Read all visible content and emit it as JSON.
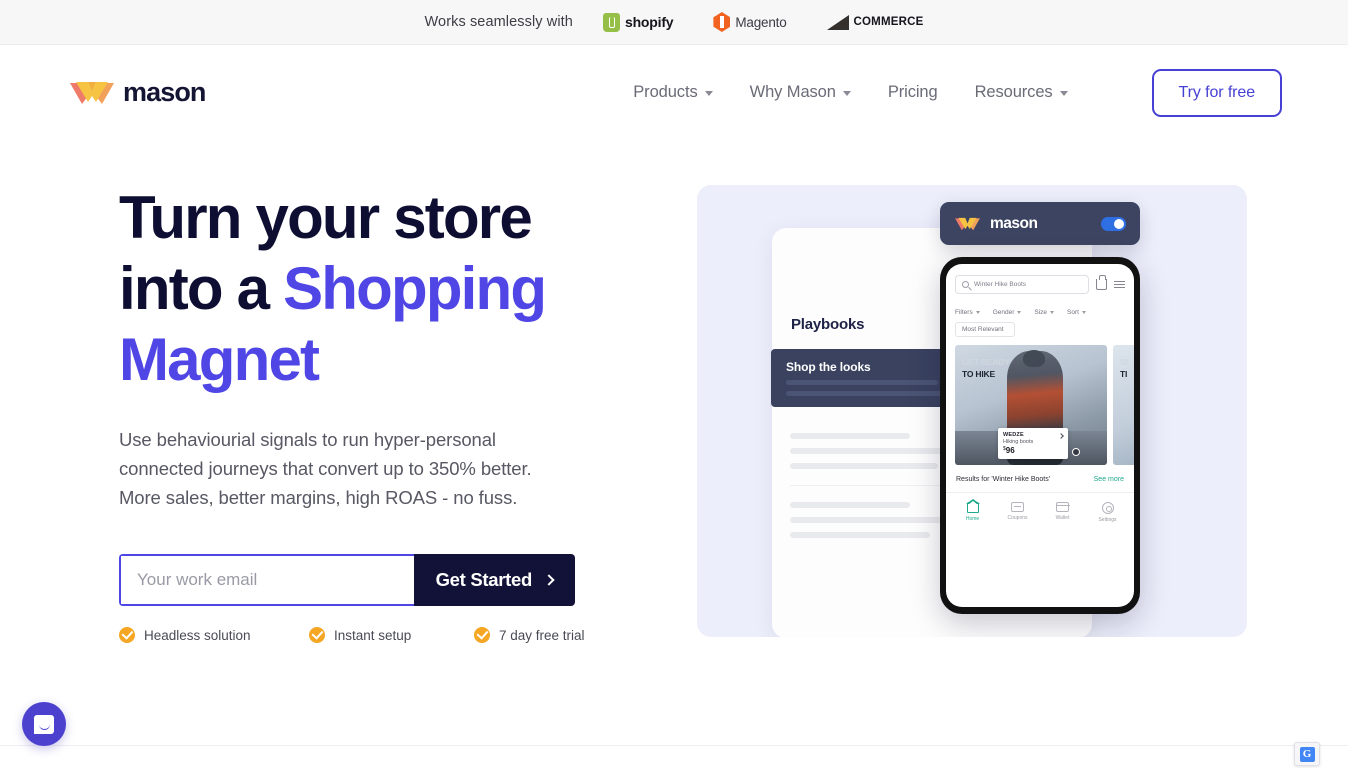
{
  "announcement": {
    "text": "Works seamlessly with",
    "platforms": [
      {
        "name": "shopify",
        "icon": "shopify-icon"
      },
      {
        "name": "Magento",
        "icon": "magento-icon"
      },
      {
        "name": "COMMERCE",
        "icon": "bigcommerce-icon"
      }
    ]
  },
  "nav": {
    "brand": "mason",
    "links": [
      {
        "label": "Products",
        "has_dropdown": true
      },
      {
        "label": "Why Mason",
        "has_dropdown": true
      },
      {
        "label": "Pricing",
        "has_dropdown": false
      },
      {
        "label": "Resources",
        "has_dropdown": true
      }
    ],
    "cta": "Try for free"
  },
  "hero": {
    "heading_line1": "Turn your store",
    "heading_line2_plain": "into a ",
    "heading_accent1": "Shopping",
    "heading_accent2": "Magnet",
    "subtext": "Use behaviourial signals to run hyper-personal connected journeys that convert up to 350% better. More sales, better margins, high ROAS - no fuss.",
    "email_placeholder": "Your work email",
    "email_value": "",
    "submit_label": "Get Started",
    "badges": [
      "Headless solution",
      "Instant setup",
      "7 day free trial"
    ]
  },
  "visual": {
    "mason_bar": {
      "brand": "mason",
      "toggle_on": true
    },
    "dashboard": {
      "title": "Playbooks",
      "active_card": "Shop the looks"
    },
    "phone": {
      "search_value": "Winter Hike Boots",
      "filters": [
        "Filters",
        "Gender",
        "Size",
        "Sort"
      ],
      "sort_chip": "Most Relevant",
      "banner_line1": "GET READY",
      "banner_line2": "TO HIKE",
      "banner2_line1": "SI",
      "banner2_line2": "TI",
      "product": {
        "brand": "WEDZE",
        "name": "Hiking boots",
        "currency": "$",
        "price": "96"
      },
      "results_text": "Results for 'Winter Hike Boots'",
      "see_more": "See more",
      "bottom_nav": [
        {
          "label": "Home",
          "icon": "home-icon",
          "active": true
        },
        {
          "label": "Coupons",
          "icon": "coupon-icon",
          "active": false
        },
        {
          "label": "Wallet",
          "icon": "wallet-icon",
          "active": false
        },
        {
          "label": "Settings",
          "icon": "settings-icon",
          "active": false
        }
      ]
    }
  },
  "widgets": {
    "chat": "intercom-chat-icon",
    "translate": "G"
  },
  "colors": {
    "accent": "#4f46e5",
    "dark": "#0e0e33",
    "badge": "#f5a623",
    "card_bg": "#eceefb"
  }
}
